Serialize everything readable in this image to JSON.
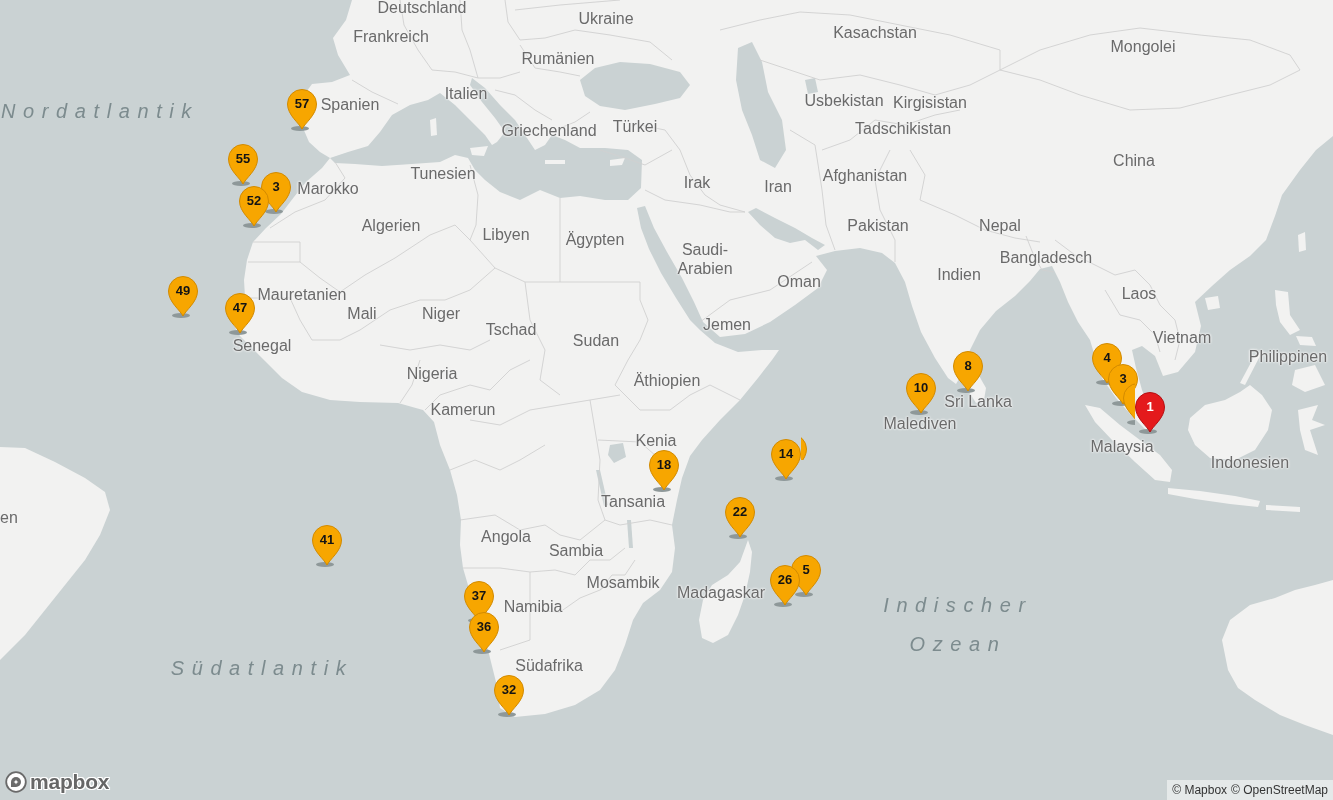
{
  "map": {
    "labels": [
      {
        "text": "Deutschland",
        "kind": "country"
      },
      {
        "text": "Frankreich",
        "kind": "country"
      },
      {
        "text": "Ukraine",
        "kind": "country"
      },
      {
        "text": "Kasachstan",
        "kind": "country"
      },
      {
        "text": "Rumänien",
        "kind": "country"
      },
      {
        "text": "Mongolei",
        "kind": "country"
      },
      {
        "text": "Nordatlantik",
        "kind": "ocean"
      },
      {
        "text": "Spanien",
        "kind": "country"
      },
      {
        "text": "Italien",
        "kind": "country"
      },
      {
        "text": "Usbekistan",
        "kind": "country"
      },
      {
        "text": "Kirgisistan",
        "kind": "country"
      },
      {
        "text": "Griechenland",
        "kind": "country"
      },
      {
        "text": "Türkei",
        "kind": "country"
      },
      {
        "text": "Tadschikistan",
        "kind": "country"
      },
      {
        "text": "China",
        "kind": "country"
      },
      {
        "text": "Marokko",
        "kind": "country"
      },
      {
        "text": "Tunesien",
        "kind": "country"
      },
      {
        "text": "Irak",
        "kind": "country"
      },
      {
        "text": "Iran",
        "kind": "country"
      },
      {
        "text": "Afghanistan",
        "kind": "country"
      },
      {
        "text": "Algerien",
        "kind": "country"
      },
      {
        "text": "Libyen",
        "kind": "country"
      },
      {
        "text": "Ägypten",
        "kind": "country"
      },
      {
        "text": "Saudi-Arabien",
        "kind": "country"
      },
      {
        "text": "Pakistan",
        "kind": "country"
      },
      {
        "text": "Nepal",
        "kind": "country"
      },
      {
        "text": "Bangladesch",
        "kind": "country"
      },
      {
        "text": "Oman",
        "kind": "country"
      },
      {
        "text": "Indien",
        "kind": "country"
      },
      {
        "text": "Mauretanien",
        "kind": "country"
      },
      {
        "text": "Laos",
        "kind": "country"
      },
      {
        "text": "Senegal",
        "kind": "country"
      },
      {
        "text": "Mali",
        "kind": "country"
      },
      {
        "text": "Niger",
        "kind": "country"
      },
      {
        "text": "Tschad",
        "kind": "country"
      },
      {
        "text": "Sudan",
        "kind": "country"
      },
      {
        "text": "Jemen",
        "kind": "country"
      },
      {
        "text": "Vietnam",
        "kind": "country"
      },
      {
        "text": "Philippinen",
        "kind": "country"
      },
      {
        "text": "Nigeria",
        "kind": "country"
      },
      {
        "text": "Äthiopien",
        "kind": "country"
      },
      {
        "text": "Kamerun",
        "kind": "country"
      },
      {
        "text": "Sri Lanka",
        "kind": "country"
      },
      {
        "text": "Kenia",
        "kind": "country"
      },
      {
        "text": "Malediven",
        "kind": "country"
      },
      {
        "text": "Malaysia",
        "kind": "country"
      },
      {
        "text": "Indonesien",
        "kind": "country"
      },
      {
        "text": "en",
        "kind": "country"
      },
      {
        "text": "Tansania",
        "kind": "country"
      },
      {
        "text": "Angola",
        "kind": "country"
      },
      {
        "text": "Sambia",
        "kind": "country"
      },
      {
        "text": "Namibia",
        "kind": "country"
      },
      {
        "text": "Mosambik",
        "kind": "country"
      },
      {
        "text": "Madagaskar",
        "kind": "country"
      },
      {
        "text": "Südatlantik",
        "kind": "ocean"
      },
      {
        "text": "Südafrika",
        "kind": "country"
      },
      {
        "text": "Indischer Ozean",
        "kind": "ocean"
      }
    ],
    "markers": [
      {
        "label": "1",
        "selected": true
      },
      {
        "selected": false
      },
      {
        "label": "3",
        "selected": false
      },
      {
        "label": "4",
        "selected": false
      },
      {
        "label": "8",
        "selected": false
      },
      {
        "label": "10",
        "selected": false
      },
      {
        "label": "14",
        "selected": false
      },
      {
        "selected": false
      },
      {
        "label": "18",
        "selected": false
      },
      {
        "label": "22",
        "selected": false
      },
      {
        "label": "5",
        "selected": false
      },
      {
        "label": "26",
        "selected": false
      },
      {
        "label": "32",
        "selected": false
      },
      {
        "label": "36",
        "selected": false
      },
      {
        "label": "37",
        "selected": false
      },
      {
        "label": "41",
        "selected": false
      },
      {
        "label": "47",
        "selected": false
      },
      {
        "label": "49",
        "selected": false
      },
      {
        "label": "52",
        "selected": false
      },
      {
        "label": "3",
        "selected": false
      },
      {
        "label": "55",
        "selected": false
      },
      {
        "label": "57",
        "selected": false
      }
    ]
  },
  "logo": {
    "wordmark": "mapbox"
  },
  "attribution": [
    "© Mapbox",
    "© OpenStreetMap"
  ]
}
